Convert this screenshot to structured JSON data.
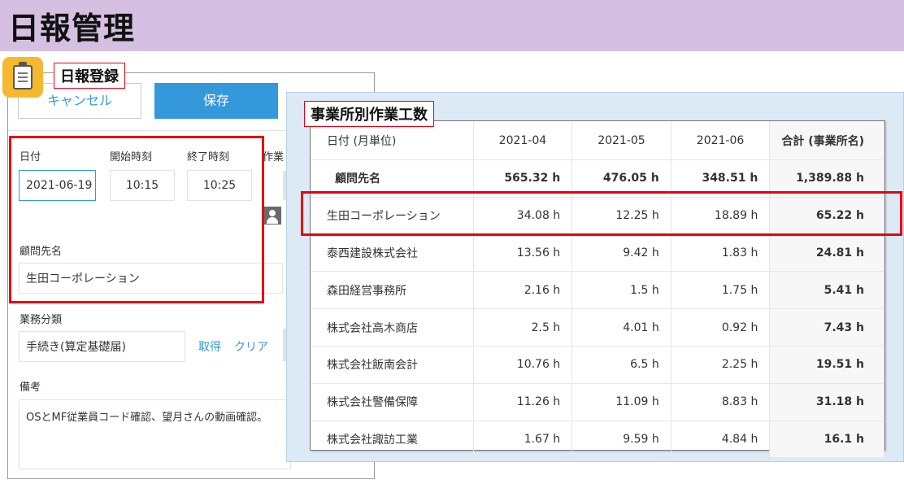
{
  "header": {
    "title": "日報管理"
  },
  "form": {
    "label": "日報登録",
    "cancel_label": "キャンセル",
    "save_label": "保存",
    "date_label": "日付",
    "date_value": "2021-06-19",
    "start_label": "開始時刻",
    "start_value": "10:15",
    "end_label": "終了時刻",
    "end_value": "10:25",
    "work_label_partial": "作業",
    "client_label": "顧問先名",
    "client_value": "生田コーポレーション",
    "category_label": "業務分類",
    "category_value": "手続き(算定基礎届)",
    "get_link": "取得",
    "clear_link": "クリア",
    "notes_label": "備考",
    "notes_value": "OSとMF従業員コード確認、望月さんの動画確認。"
  },
  "table": {
    "label": "事業所別作業工数",
    "headers": [
      "日付 (月単位)",
      "2021-04",
      "2021-05",
      "2021-06",
      "合計 (事業所名)"
    ],
    "total_row": [
      "顧問先名",
      "565.32 h",
      "476.05 h",
      "348.51 h",
      "1,389.88 h"
    ],
    "rows": [
      [
        "生田コーポレーション",
        "34.08 h",
        "12.25 h",
        "18.89 h",
        "65.22 h"
      ],
      [
        "泰西建設株式会社",
        "13.56 h",
        "9.42 h",
        "1.83 h",
        "24.81 h"
      ],
      [
        "森田経営事務所",
        "2.16 h",
        "1.5 h",
        "1.75 h",
        "5.41 h"
      ],
      [
        "株式会社高木商店",
        "2.5 h",
        "4.01 h",
        "0.92 h",
        "7.43 h"
      ],
      [
        "株式会社飯南会計",
        "10.76 h",
        "6.5 h",
        "2.25 h",
        "19.51 h"
      ],
      [
        "株式会社警備保障",
        "11.26 h",
        "11.09 h",
        "8.83 h",
        "31.18 h"
      ],
      [
        "株式会社諏訪工業",
        "1.67 h",
        "9.59 h",
        "4.84 h",
        "16.1 h"
      ]
    ]
  },
  "icons": {
    "app": "clipboard-icon",
    "user": "user-icon"
  },
  "colors": {
    "header_bg": "#d5c0e1",
    "accent": "#3498db",
    "highlight": "#e60012",
    "app_icon": "#f5b82e",
    "table_panel_bg": "#dceaf5"
  }
}
